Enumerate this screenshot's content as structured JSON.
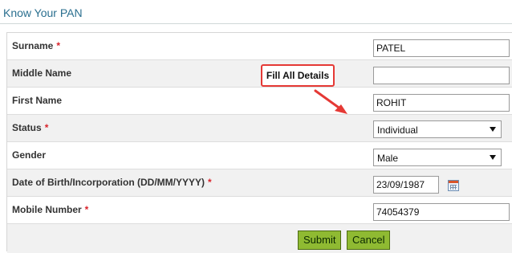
{
  "header": {
    "title": "Know Your PAN"
  },
  "form": {
    "surname": {
      "label": "Surname",
      "required": "*",
      "value": "PATEL"
    },
    "middle_name": {
      "label": "Middle Name",
      "value": ""
    },
    "first_name": {
      "label": "First Name",
      "value": "ROHIT"
    },
    "status": {
      "label": "Status",
      "required": "*",
      "selected": "Individual"
    },
    "gender": {
      "label": "Gender",
      "selected": "Male"
    },
    "dob": {
      "label": "Date of Birth/Incorporation (DD/MM/YYYY)",
      "required": "*",
      "value": "23/09/1987"
    },
    "mobile": {
      "label": "Mobile Number",
      "required": "*",
      "value": "74054379"
    }
  },
  "buttons": {
    "submit": "Submit",
    "cancel": "Cancel"
  },
  "annotation": {
    "text": "Fill All Details",
    "color": "#e53935"
  },
  "colors": {
    "title": "#2a6f8f",
    "button": "#8fba32",
    "required": "#d9232b"
  }
}
